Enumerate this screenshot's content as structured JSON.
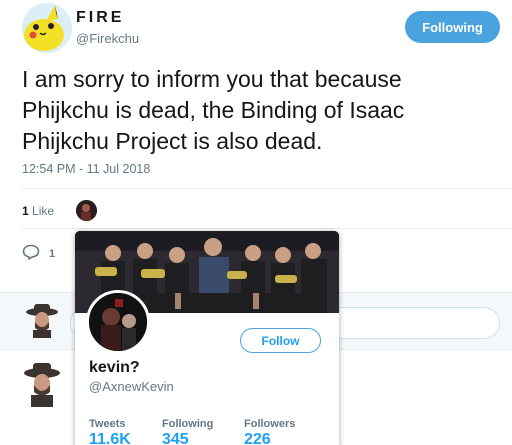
{
  "header": {
    "display_name": "FIRE",
    "handle": "@Firekchu",
    "following_label": "Following"
  },
  "tweet": {
    "text": "I am sorry to inform you that because Phijkchu is dead, the Binding of Isaac Phijkchu Project is also dead.",
    "timestamp": "12:54 PM - 11 Jul 2018",
    "likes_count": "1",
    "likes_label": "Like",
    "reply_count": "1"
  },
  "hover_card": {
    "name": "kevin?",
    "handle": "@AxnewKevin",
    "follow_label": "Follow",
    "stats": [
      {
        "label": "Tweets",
        "value": "11.6K"
      },
      {
        "label": "Following",
        "value": "345"
      },
      {
        "label": "Followers",
        "value": "226"
      }
    ]
  },
  "colors": {
    "accent": "#1da1f2",
    "button_fill": "#4aa3df",
    "muted": "#657786"
  },
  "icons": [
    "pikachu-avatar-icon",
    "reply-icon",
    "liker-avatar-icon",
    "cowboy-hat-avatar-icon"
  ]
}
